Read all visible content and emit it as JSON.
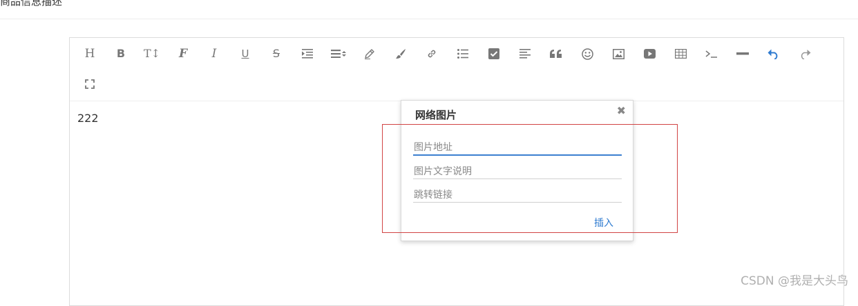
{
  "page": {
    "title": "商品信息描述"
  },
  "toolbar": {
    "tools": [
      {
        "name": "heading",
        "icon": "heading-icon",
        "glyph": "H"
      },
      {
        "name": "bold",
        "icon": "bold-icon",
        "glyph": "B"
      },
      {
        "name": "font-size",
        "icon": "font-size-icon",
        "glyph": "T↕"
      },
      {
        "name": "font-family",
        "icon": "font-family-icon",
        "glyph": "F"
      },
      {
        "name": "italic",
        "icon": "italic-icon",
        "glyph": "I"
      },
      {
        "name": "underline",
        "icon": "underline-icon",
        "glyph": "U"
      },
      {
        "name": "strikethrough",
        "icon": "strikethrough-icon",
        "glyph": "S"
      },
      {
        "name": "indent",
        "icon": "indent-icon"
      },
      {
        "name": "line-height",
        "icon": "line-height-icon"
      },
      {
        "name": "font-color",
        "icon": "pencil-icon"
      },
      {
        "name": "background-color",
        "icon": "paint-brush-icon"
      },
      {
        "name": "link",
        "icon": "link-icon"
      },
      {
        "name": "list",
        "icon": "list-icon"
      },
      {
        "name": "todo",
        "icon": "checkbox-icon"
      },
      {
        "name": "justify",
        "icon": "align-left-icon"
      },
      {
        "name": "quote",
        "icon": "quote-icon"
      },
      {
        "name": "emoticon",
        "icon": "smile-icon"
      },
      {
        "name": "image",
        "icon": "image-icon"
      },
      {
        "name": "video",
        "icon": "video-icon"
      },
      {
        "name": "table",
        "icon": "table-icon"
      },
      {
        "name": "code",
        "icon": "code-icon"
      },
      {
        "name": "split-line",
        "icon": "horizontal-rule-icon"
      },
      {
        "name": "undo",
        "icon": "undo-icon"
      },
      {
        "name": "redo",
        "icon": "redo-icon"
      },
      {
        "name": "fullscreen",
        "icon": "fullscreen-icon"
      }
    ]
  },
  "editor": {
    "content": "222"
  },
  "image_dialog": {
    "title": "网络图片",
    "close_glyph": "✖",
    "url": {
      "placeholder": "图片地址",
      "value": ""
    },
    "alt": {
      "placeholder": "图片文字说明",
      "value": ""
    },
    "href": {
      "placeholder": "跳转链接",
      "value": ""
    },
    "insert_label": "插入"
  },
  "watermark": "CSDN @我是大头鸟",
  "colors": {
    "accent": "#2f7bd0",
    "highlight_border": "#d14343",
    "icon": "#777777"
  }
}
